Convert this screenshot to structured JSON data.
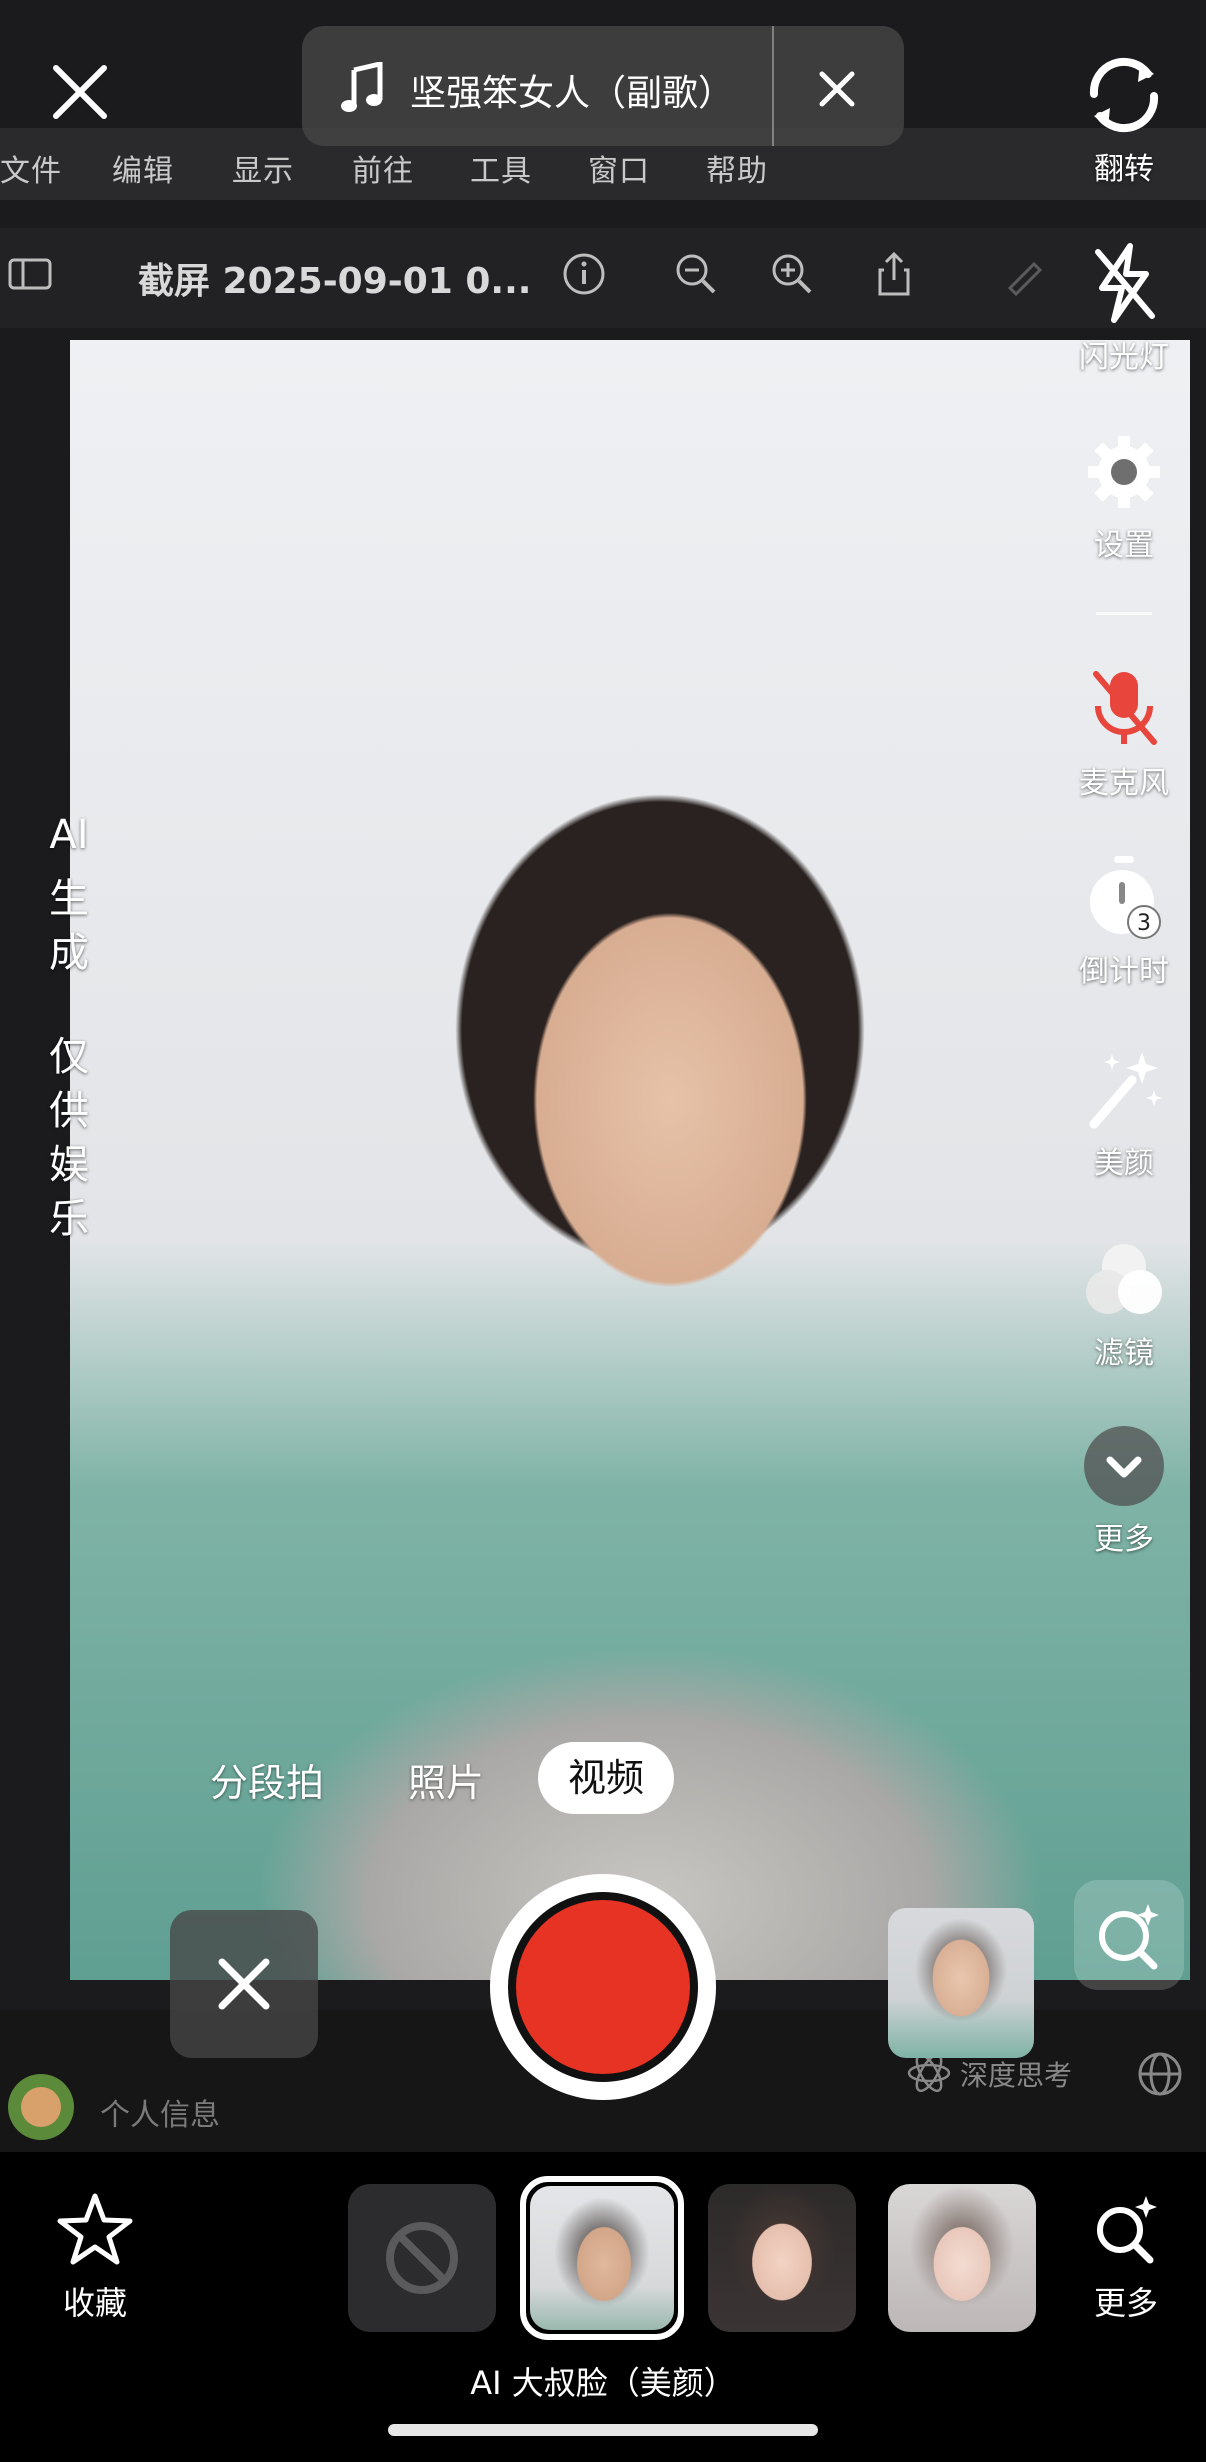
{
  "top_bar": {
    "music_title": "坚强笨女人（副歌）"
  },
  "mac_screen": {
    "menu": [
      "文件",
      "编辑",
      "显示",
      "前往",
      "工具",
      "窗口",
      "帮助"
    ],
    "file_title": "截屏 2025-09-01 0...",
    "profile_label": "个人信息",
    "deep_think_label": "深度思考"
  },
  "side_controls": [
    {
      "label": "翻转",
      "icon": "flip-camera-icon"
    },
    {
      "label": "闪光灯",
      "icon": "flash-off-icon"
    },
    {
      "label": "设置",
      "icon": "gear-icon"
    },
    {
      "label": "麦克风",
      "icon": "mic-muted-icon"
    },
    {
      "label": "倒计时",
      "icon": "timer-icon",
      "badge": "3"
    },
    {
      "label": "美颜",
      "icon": "magic-wand-icon"
    },
    {
      "label": "滤镜",
      "icon": "filter-circles-icon"
    },
    {
      "label": "更多",
      "icon": "chevron-down-icon"
    }
  ],
  "watermark": [
    "AI",
    "生",
    "成",
    "仅",
    "供",
    "娱",
    "乐"
  ],
  "modes": {
    "segment": "分段拍",
    "photo": "照片",
    "video": "视频"
  },
  "tray": {
    "favorite_label": "收藏",
    "more_label": "更多",
    "selected_effect_name": "AI 大叔脸（美颜）"
  },
  "colors": {
    "record": "#e63324",
    "mic_muted": "#e8453c"
  }
}
